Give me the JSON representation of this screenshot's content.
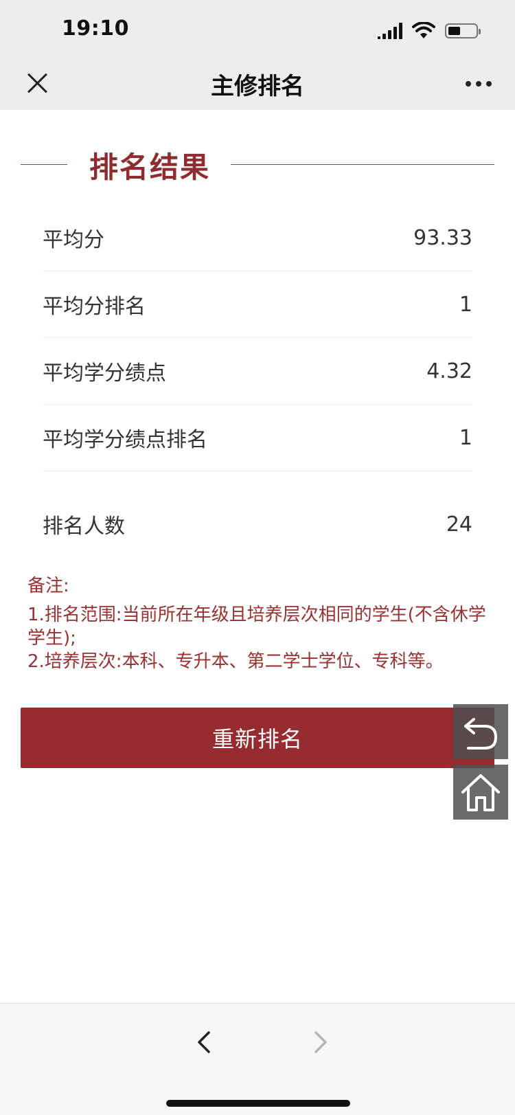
{
  "status_bar": {
    "time": "19:10",
    "battery_level": 0.45
  },
  "nav": {
    "title": "主修排名"
  },
  "section": {
    "title": "排名结果"
  },
  "results": [
    {
      "label": "平均分",
      "value": "93.33"
    },
    {
      "label": "平均分排名",
      "value": "1"
    },
    {
      "label": "平均学分绩点",
      "value": "4.32"
    },
    {
      "label": "平均学分绩点排名",
      "value": "1"
    },
    {
      "label": "排名人数",
      "value": "24"
    }
  ],
  "remarks": {
    "title": "备注:",
    "line1": "1.排名范围:当前所在年级且培养层次相同的学生(不含休学学生);",
    "line2": "2.培养层次:本科、专升本、第二学士学位、专科等。"
  },
  "actions": {
    "rerank_label": "重新排名"
  },
  "colors": {
    "accent": "#962c2f",
    "remark_text": "#9b3030",
    "nav_bg": "#ededed"
  },
  "icons": [
    "close-icon",
    "more-icon",
    "back-icon",
    "home-icon",
    "chevron-left-icon",
    "chevron-right-icon"
  ]
}
